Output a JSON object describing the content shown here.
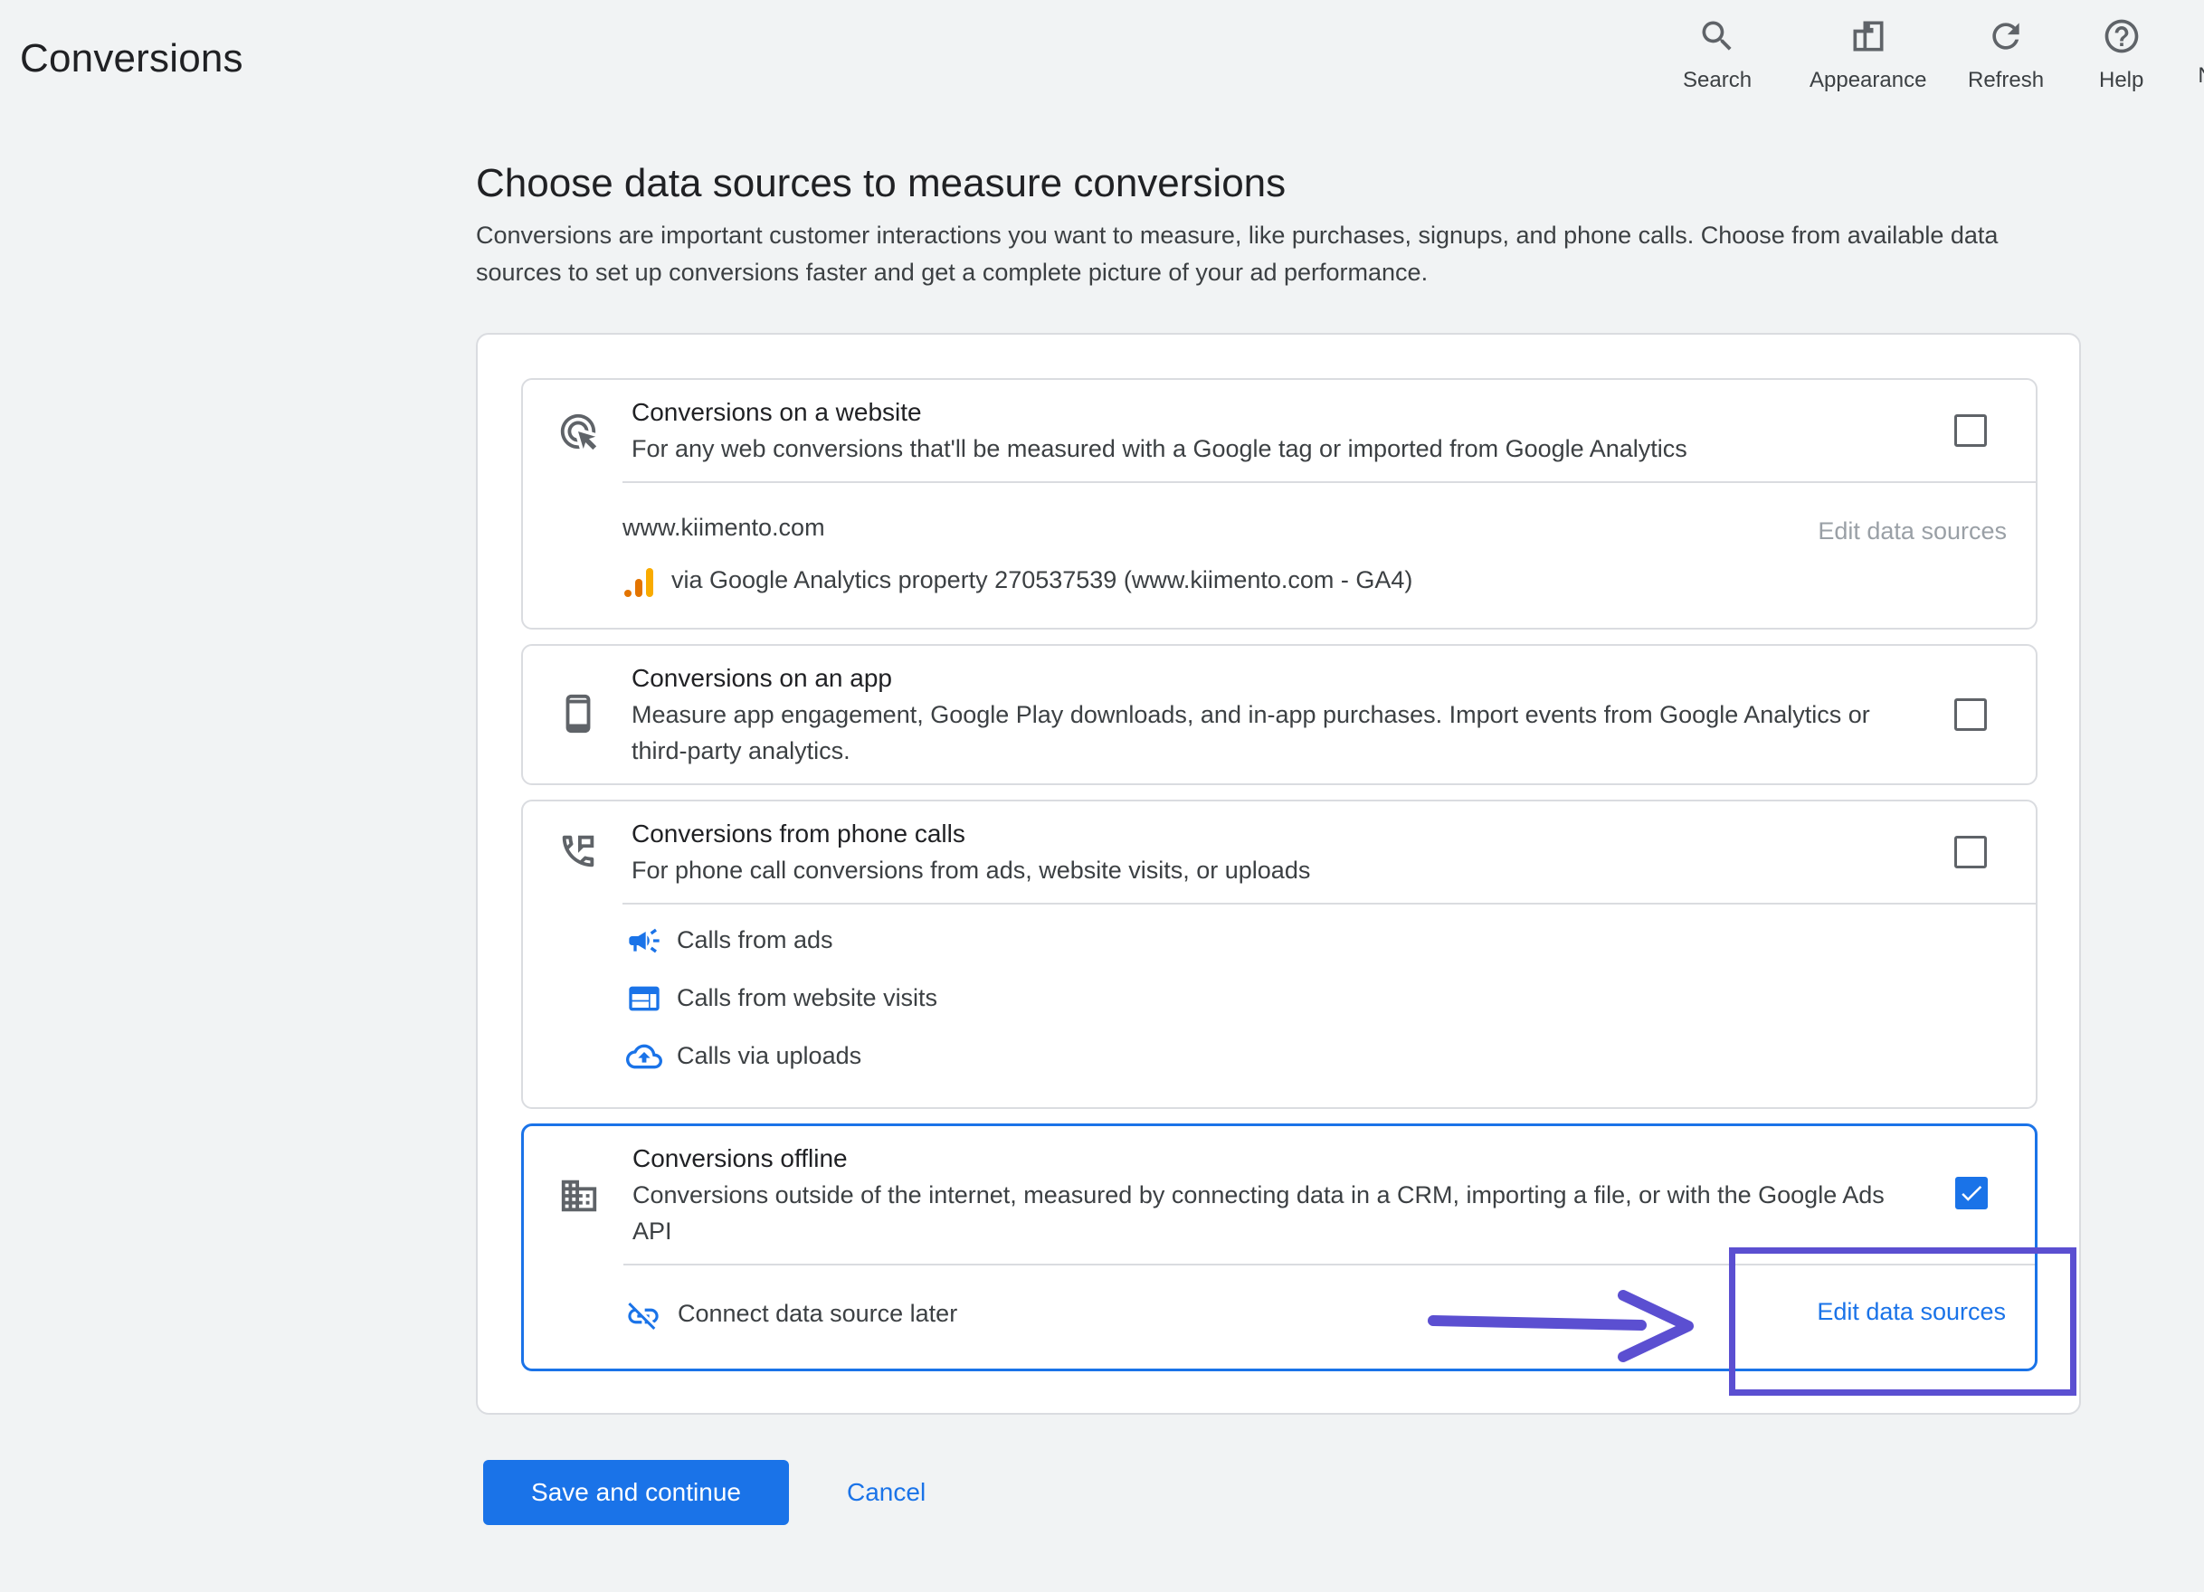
{
  "header": {
    "title": "Conversions",
    "tools": [
      {
        "label": "Search",
        "icon": "search-icon"
      },
      {
        "label": "Appearance",
        "icon": "appearance-icon"
      },
      {
        "label": "Refresh",
        "icon": "refresh-icon"
      },
      {
        "label": "Help",
        "icon": "help-icon"
      },
      {
        "label": "N",
        "icon": ""
      }
    ]
  },
  "intro": {
    "title": "Choose data sources to measure conversions",
    "description": "Conversions are important customer interactions you want to measure, like purchases, signups, and phone calls. Choose from available data sources to set up conversions faster and get a complete picture of your ad performance."
  },
  "cards": {
    "website": {
      "title": "Conversions on a website",
      "description": "For any web conversions that'll be measured with a Google tag or imported from Google Analytics",
      "checked": false,
      "domain": "www.kiimento.com",
      "source": "via Google Analytics property 270537539 (www.kiimento.com - GA4)",
      "edit_label": "Edit data sources"
    },
    "app": {
      "title": "Conversions on an app",
      "description": "Measure app engagement, Google Play downloads, and in-app purchases. Import events from Google Analytics or third-party analytics.",
      "checked": false
    },
    "phone": {
      "title": "Conversions from phone calls",
      "description": "For phone call conversions from ads, website visits, or uploads",
      "checked": false,
      "items": [
        {
          "label": "Calls from ads",
          "icon": "megaphone-icon"
        },
        {
          "label": "Calls from website visits",
          "icon": "web-icon"
        },
        {
          "label": "Calls via uploads",
          "icon": "cloud-upload-icon"
        }
      ]
    },
    "offline": {
      "title": "Conversions offline",
      "description": "Conversions outside of the internet, measured by connecting data in a CRM, importing a file, or with the Google Ads API",
      "checked": true,
      "connect_label": "Connect data source later",
      "edit_label": "Edit data sources"
    }
  },
  "actions": {
    "save_label": "Save and continue",
    "cancel_label": "Cancel"
  },
  "colors": {
    "accent": "#1a73e8",
    "annotation": "#5b4fd1",
    "analytics_orange": "#f9ab00",
    "analytics_dark_orange": "#e37400"
  }
}
